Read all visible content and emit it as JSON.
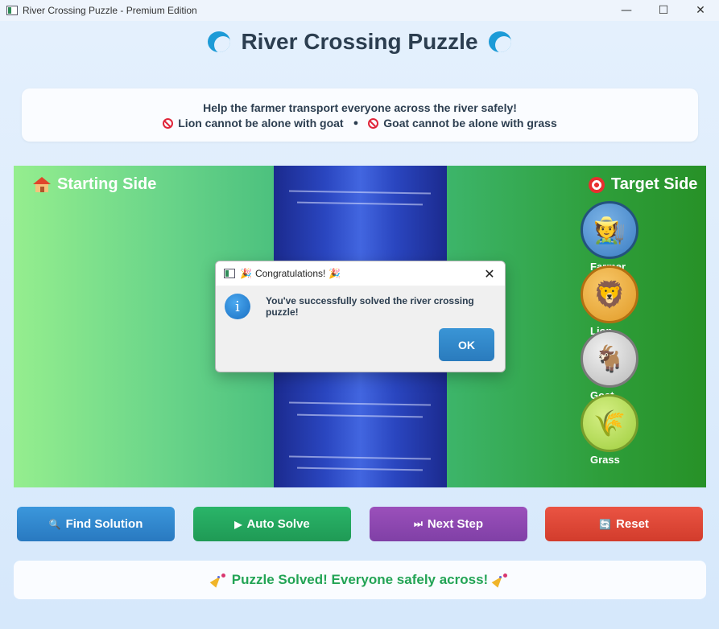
{
  "window": {
    "title": "River Crossing Puzzle - Premium Edition",
    "min_glyph": "—",
    "max_glyph": "☐",
    "close_glyph": "✕"
  },
  "header": {
    "title": "River Crossing Puzzle"
  },
  "rules": {
    "line1": "Help the farmer transport everyone across the river safely!",
    "rule1": "Lion cannot be alone with goat",
    "separator": "●",
    "rule2": "Goat cannot be alone with grass"
  },
  "board": {
    "left_label": "Starting Side",
    "right_label": "Target Side",
    "characters": [
      {
        "name": "Farmer",
        "glyph": "🧑‍🌾",
        "side": "target"
      },
      {
        "name": "Lion",
        "glyph": "🦁",
        "side": "target"
      },
      {
        "name": "Goat",
        "glyph": "🐐",
        "side": "target"
      },
      {
        "name": "Grass",
        "glyph": "🌾",
        "side": "target"
      }
    ]
  },
  "buttons": {
    "find": "Find Solution",
    "auto": "Auto Solve",
    "next": "Next Step",
    "reset": "Reset",
    "find_icon": "🔍",
    "auto_icon": "▶",
    "next_icon": "⏭",
    "reset_icon": "🔄"
  },
  "status": {
    "text": "Puzzle Solved! Everyone safely across!"
  },
  "dialog": {
    "title": "Congratulations!",
    "message": "You've successfully solved the river crossing puzzle!",
    "ok": "OK",
    "info_glyph": "i",
    "close_glyph": "✕",
    "title_icon": "🎉"
  },
  "colors": {
    "accent_blue": "#2a7bbd",
    "status_green": "#23a455",
    "river": "#2a46c0"
  }
}
